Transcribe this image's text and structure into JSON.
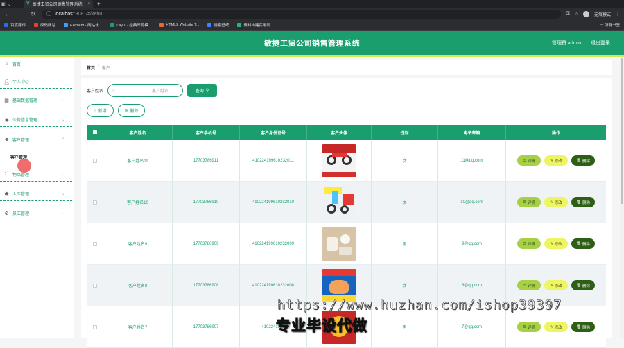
{
  "browser": {
    "tab_title": "敏捷工贸公司销售管理系统",
    "url_host": "localhost",
    "url_path": ":8081/#/kehu",
    "profile_label": "无痕模式",
    "bookmarks": [
      {
        "label": "百度翻译",
        "color": "#2b6de8"
      },
      {
        "label": "原码网站",
        "color": "#e8412b"
      },
      {
        "label": "Element - 网站快...",
        "color": "#409eff"
      },
      {
        "label": "Layui - 经典开源模...",
        "color": "#1a9e6e"
      },
      {
        "label": "HTML5 Website T...",
        "color": "#e86a2b"
      },
      {
        "label": "搜索壁纸",
        "color": "#3a86ff"
      },
      {
        "label": "素材构建实用网",
        "color": "#2bb673"
      }
    ],
    "bookmarks_right": "所有书签"
  },
  "header": {
    "title": "敏捷工贸公司销售管理系统",
    "user_label": "管理员 admin",
    "logout_label": "退出登录"
  },
  "sidebar": {
    "items": [
      {
        "label": "首页",
        "icon": "home-icon"
      },
      {
        "label": "个人中心",
        "icon": "user-icon"
      },
      {
        "label": "基础数据管理",
        "icon": "chart-icon"
      },
      {
        "label": "公告信息管理",
        "icon": "bell-icon"
      },
      {
        "label": "客户管理",
        "icon": "customer-icon"
      },
      {
        "label": "物品管理",
        "icon": "box-icon"
      },
      {
        "label": "入库管理",
        "icon": "inbound-icon"
      },
      {
        "label": "员工管理",
        "icon": "staff-icon"
      }
    ],
    "sub_item": "客户管理"
  },
  "breadcrumb": {
    "home": "首页",
    "separator": "/",
    "current": "客户"
  },
  "search": {
    "label": "客户姓名",
    "placeholder": "客户姓名",
    "button": "查询"
  },
  "actions": {
    "add": "新增",
    "delete": "删除"
  },
  "table": {
    "headers": [
      "客户姓名",
      "客户手机号",
      "客户身份证号",
      "客户头像",
      "性别",
      "电子邮箱",
      "操作"
    ],
    "rows": [
      {
        "name": "客户姓名11",
        "phone": "17703786911",
        "idcard": "410224199610232011",
        "gender": "女",
        "email": "11@qq.com"
      },
      {
        "name": "客户姓名10",
        "phone": "17703786910",
        "idcard": "410224199610232010",
        "gender": "女",
        "email": "10@qq.com"
      },
      {
        "name": "客户姓名9",
        "phone": "17703786909",
        "idcard": "410224199610232009",
        "gender": "男",
        "email": "9@qq.com"
      },
      {
        "name": "客户姓名8",
        "phone": "17703786908",
        "idcard": "410224199610232008",
        "gender": "女",
        "email": "8@qq.com"
      },
      {
        "name": "客户姓名7",
        "phone": "17703786907",
        "idcard": "4102241996",
        "gender": "男",
        "email": "7@qq.com"
      }
    ],
    "op_detail": "详情",
    "op_edit": "修改",
    "op_delete": "删除"
  },
  "overlay": {
    "watermark": "https://www.huzhan.com/ishop39397",
    "caption": "专业毕设代做"
  },
  "colors": {
    "primary": "#1a9e6e",
    "accent": "#d5e84f",
    "detail_btn": "#a7d046",
    "edit_btn": "#eef562",
    "delete_btn": "#2d5f14"
  }
}
